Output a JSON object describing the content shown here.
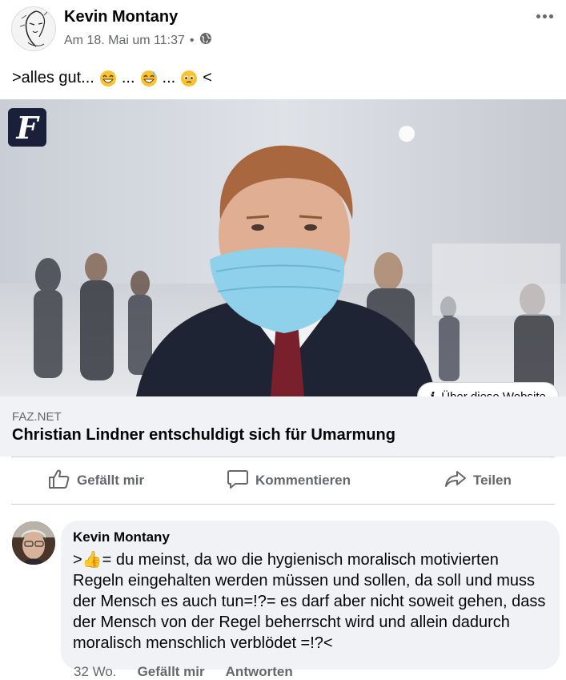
{
  "post": {
    "author": "Kevin Montany",
    "timestamp": "Am 18. Mai um 11:37",
    "separator": "•",
    "privacy_icon": "globe-icon",
    "more_icon": "ellipsis-icon",
    "text_start": ">alles gut...",
    "text_dots_1": "...",
    "text_dots_2": "...",
    "text_end": "<",
    "emojis": [
      "grin-emoji",
      "sweat-smile-emoji",
      "pleading-emoji"
    ]
  },
  "link": {
    "logo_letter": "F",
    "about_label": "Über diese Website",
    "domain": "FAZ.NET",
    "title": "Christian Lindner entschuldigt sich für Umarmung"
  },
  "actions": {
    "like": "Gefällt mir",
    "comment": "Kommentieren",
    "share": "Teilen"
  },
  "comment": {
    "author": "Kevin Montany",
    "text": ">👍= du meinst, da wo die hygienisch moralisch motivierten Regeln eingehalten werden müssen und sollen, da soll und muss der Mensch es auch tun=!?= es darf aber nicht soweit gehen, dass der Mensch von der Regel  beherrscht wird und allein dadurch moralisch menschlich verblödet =!?<",
    "age": "32 Wo.",
    "like": "Gefällt mir",
    "reply": "Antworten"
  },
  "colors": {
    "primary_text": "#050505",
    "secondary_text": "#65676b",
    "bubble_bg": "#f0f2f5",
    "divider": "#ced0d4"
  }
}
